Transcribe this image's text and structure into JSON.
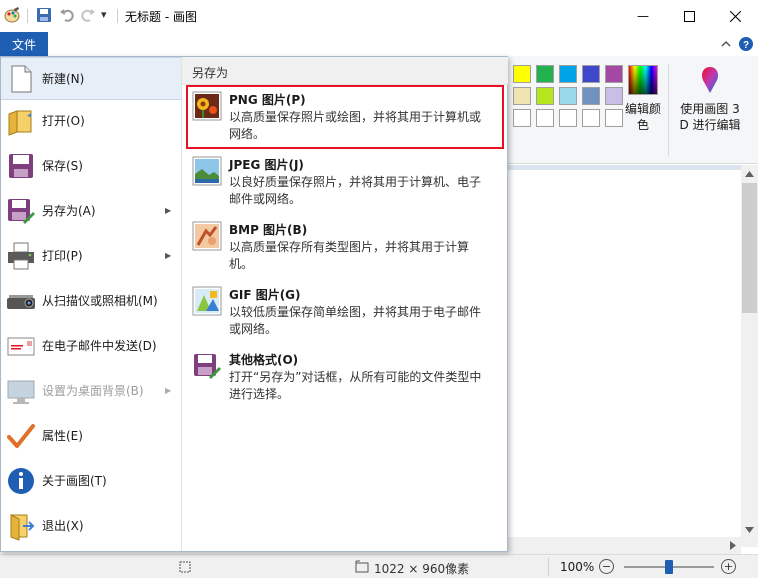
{
  "window": {
    "title": "无标题 - 画图",
    "minimize_glyph": "—",
    "maximize_glyph": "☐",
    "close_glyph": "✕"
  },
  "quick_access": {
    "dropdown_glyph": "▾"
  },
  "ribbon": {
    "file_tab": "文件",
    "edit_colors_label": "编辑颜色",
    "paint3d_label": "使用画图 3 D 进行编辑",
    "palette_row1": [
      "#ffff00",
      "#22b14c",
      "#00a2e8",
      "#3f48cc",
      "#a349a4"
    ],
    "palette_row2": [
      "#efe4b0",
      "#b5e61d",
      "#99d9ea",
      "#7092be",
      "#c8bfe7"
    ]
  },
  "file_menu": {
    "left_items": [
      {
        "label": "新建(N)",
        "icon": "new-file-icon",
        "has_submenu": false,
        "disabled": false,
        "active": true
      },
      {
        "label": "打开(O)",
        "icon": "open-folder-icon",
        "has_submenu": false,
        "disabled": false
      },
      {
        "label": "保存(S)",
        "icon": "save-disk-icon",
        "has_submenu": false,
        "disabled": false
      },
      {
        "label": "另存为(A)",
        "icon": "save-as-icon",
        "has_submenu": true,
        "disabled": false
      },
      {
        "label": "打印(P)",
        "icon": "printer-icon",
        "has_submenu": true,
        "disabled": false
      },
      {
        "label": "从扫描仪或照相机(M)",
        "icon": "scanner-icon",
        "has_submenu": false,
        "disabled": false
      },
      {
        "label": "在电子邮件中发送(D)",
        "icon": "email-icon",
        "has_submenu": false,
        "disabled": false
      },
      {
        "label": "设置为桌面背景(B)",
        "icon": "desktop-background-icon",
        "has_submenu": true,
        "disabled": true
      },
      {
        "label": "属性(E)",
        "icon": "checkmark-icon",
        "has_submenu": false,
        "disabled": false
      },
      {
        "label": "关于画图(T)",
        "icon": "info-icon",
        "has_submenu": false,
        "disabled": false
      },
      {
        "label": "退出(X)",
        "icon": "exit-icon",
        "has_submenu": false,
        "disabled": false
      }
    ],
    "submenu_arrow": "▶",
    "right_header": "另存为",
    "save_as_options": [
      {
        "title": "PNG 图片(P)",
        "desc": "以高质量保存照片或绘图，并将其用于计算机或网络。",
        "icon": "png-image-icon",
        "highlighted": true
      },
      {
        "title": "JPEG 图片(J)",
        "desc": "以良好质量保存照片，并将其用于计算机、电子邮件或网络。",
        "icon": "jpeg-image-icon",
        "highlighted": false
      },
      {
        "title": "BMP 图片(B)",
        "desc": "以高质量保存所有类型图片，并将其用于计算机。",
        "icon": "bmp-image-icon",
        "highlighted": false
      },
      {
        "title": "GIF 图片(G)",
        "desc": "以较低质量保存简单绘图，并将其用于电子邮件或网络。",
        "icon": "gif-image-icon",
        "highlighted": false
      },
      {
        "title": "其他格式(O)",
        "desc": "打开“另存为”对话框，从所有可能的文件类型中进行选择。",
        "icon": "other-formats-icon",
        "highlighted": false
      }
    ]
  },
  "statusbar": {
    "dimensions": "1022 × 960像素",
    "zoom": "100%",
    "zoom_out_glyph": "−",
    "zoom_in_glyph": "+",
    "zoom_level": 0.5
  },
  "colors": {
    "file_tab": "#1e5fb4",
    "highlight_border": "#e81123",
    "canvas_background": "#dbe4ee"
  }
}
